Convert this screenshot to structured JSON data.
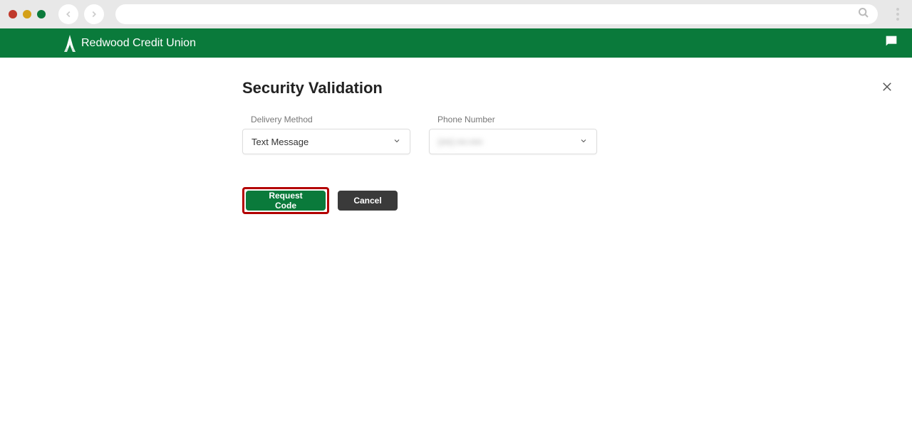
{
  "brand": {
    "name": "Redwood Credit Union"
  },
  "page": {
    "title": "Security Validation"
  },
  "form": {
    "delivery_method": {
      "label": "Delivery Method",
      "value": "Text Message"
    },
    "phone_number": {
      "label": "Phone Number",
      "value": "(•••) •••-••••"
    }
  },
  "buttons": {
    "request_code": "Request Code",
    "cancel": "Cancel"
  }
}
